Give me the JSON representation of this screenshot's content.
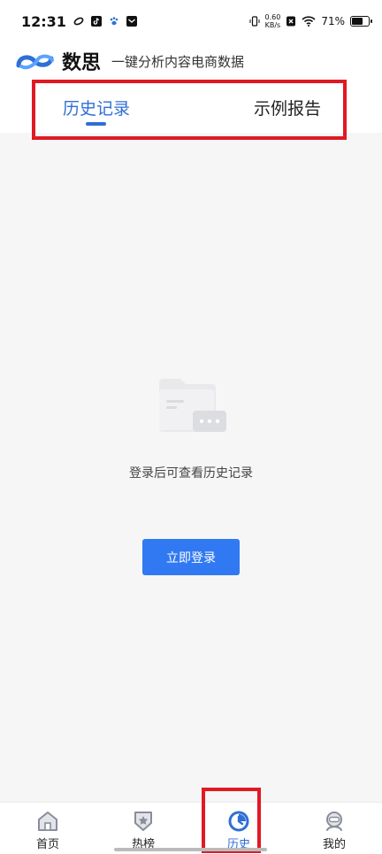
{
  "status_bar": {
    "time": "12:31",
    "net_speed_value": "0.60",
    "net_speed_unit": "KB/s",
    "battery": "71%",
    "battery_level": 0.71
  },
  "header": {
    "brand": "数思",
    "slogan": "一键分析内容电商数据"
  },
  "tabs": [
    {
      "label": "历史记录",
      "active": true
    },
    {
      "label": "示例报告",
      "active": false
    }
  ],
  "empty_state": {
    "message": "登录后可查看历史记录",
    "button_label": "立即登录"
  },
  "bottom_nav": [
    {
      "label": "首页",
      "icon": "home-icon"
    },
    {
      "label": "热榜",
      "icon": "hot-list-icon"
    },
    {
      "label": "历史",
      "icon": "history-clock-icon",
      "active": true
    },
    {
      "label": "我的",
      "icon": "profile-icon"
    }
  ],
  "colors": {
    "accent": "#2f6fd6",
    "button": "#3079f2",
    "highlight": "#e01923",
    "background": "#f6f6f7"
  }
}
